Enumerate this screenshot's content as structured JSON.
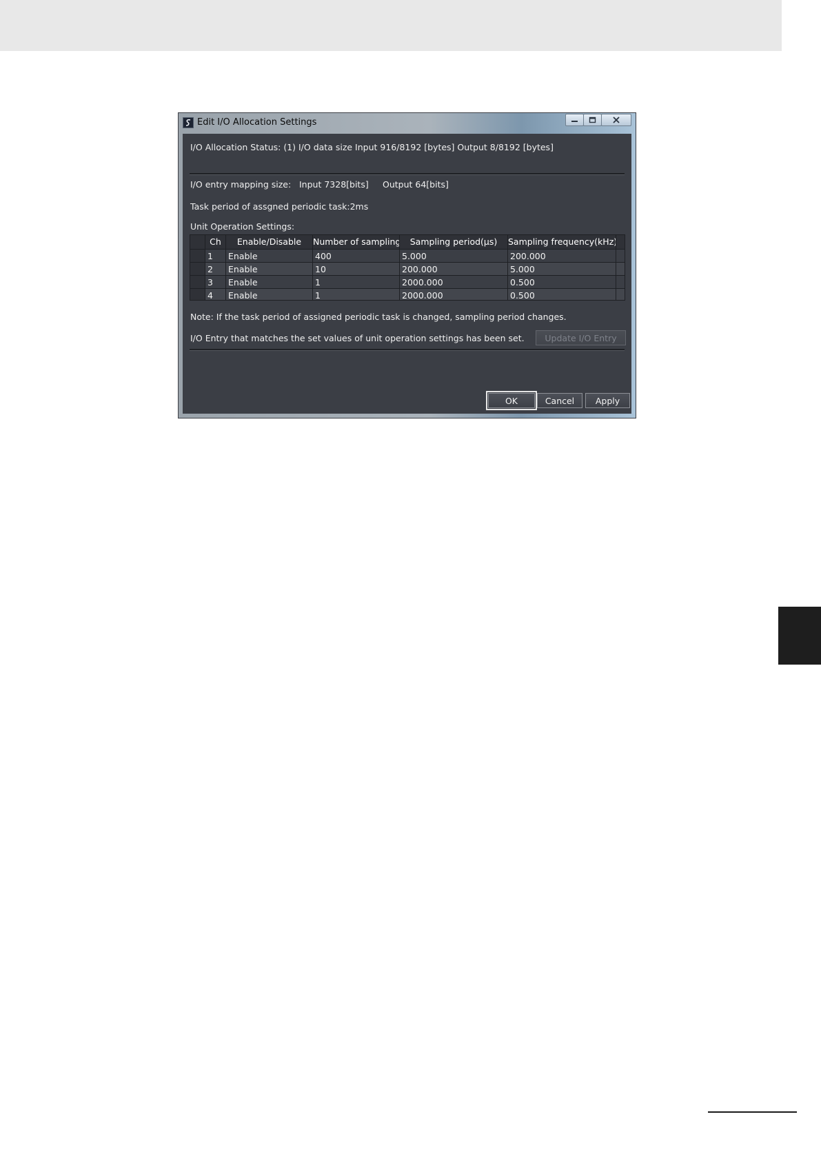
{
  "window": {
    "title": "Edit I/O Allocation Settings",
    "caption_buttons": [
      "minimize-icon",
      "maximize-icon",
      "close-icon"
    ]
  },
  "status": {
    "allocation": "I/O Allocation Status: (1) I/O data size Input 916/8192 [bytes] Output 8/8192 [bytes]",
    "mapping_label": "I/O entry mapping size:",
    "mapping_input": "Input 7328[bits]",
    "mapping_output": "Output 64[bits]",
    "task_period": "Task period of assgned periodic task:2ms",
    "unit_settings_label": "Unit Operation Settings:"
  },
  "table": {
    "columns": [
      "Ch",
      "Enable/Disable",
      "Number of sampling",
      "Sampling period(µs)",
      "Sampling frequency(kHz)"
    ],
    "rows": [
      [
        "1",
        "Enable",
        "400",
        "5.000",
        "200.000"
      ],
      [
        "2",
        "Enable",
        "10",
        "200.000",
        "5.000"
      ],
      [
        "3",
        "Enable",
        "1",
        "2000.000",
        "0.500"
      ],
      [
        "4",
        "Enable",
        "1",
        "2000.000",
        "0.500"
      ]
    ]
  },
  "notes": {
    "note": "Note: If the task period of assigned periodic task is changed, sampling period changes.",
    "entry_status": "I/O Entry that matches the set values of unit operation settings has been set."
  },
  "buttons": {
    "update": "Update I/O Entry",
    "ok": "OK",
    "cancel": "Cancel",
    "apply": "Apply"
  }
}
